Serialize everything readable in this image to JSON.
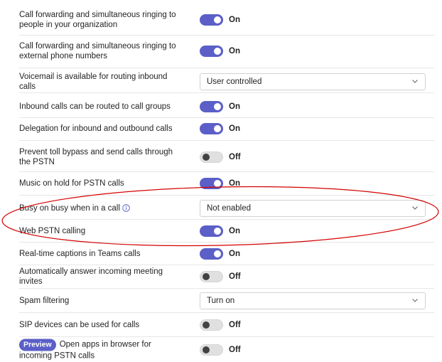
{
  "settings": [
    {
      "label": "Call forwarding and simultaneous ringing to people in your organization",
      "type": "toggle",
      "on": true,
      "state": "On"
    },
    {
      "label": "Call forwarding and simultaneous ringing to external phone numbers",
      "type": "toggle",
      "on": true,
      "state": "On"
    },
    {
      "label": "Voicemail is available for routing inbound calls",
      "type": "select",
      "value": "User controlled"
    },
    {
      "label": "Inbound calls can be routed to call groups",
      "type": "toggle",
      "on": true,
      "state": "On"
    },
    {
      "label": "Delegation for inbound and outbound calls",
      "type": "toggle",
      "on": true,
      "state": "On"
    },
    {
      "label": "Prevent toll bypass and send calls through the PSTN",
      "type": "toggle",
      "on": false,
      "state": "Off"
    },
    {
      "label": "Music on hold for PSTN calls",
      "type": "toggle",
      "on": true,
      "state": "On"
    },
    {
      "label": "Busy on busy when in a call",
      "type": "select",
      "value": "Not enabled",
      "info_icon": "info-icon"
    },
    {
      "label": "Web PSTN calling",
      "type": "toggle",
      "on": true,
      "state": "On"
    },
    {
      "label": "Real-time captions in Teams calls",
      "type": "toggle",
      "on": true,
      "state": "On"
    },
    {
      "label": "Automatically answer incoming meeting invites",
      "type": "toggle",
      "on": false,
      "state": "Off"
    },
    {
      "label": "Spam filtering",
      "type": "select",
      "value": "Turn on"
    },
    {
      "label": "SIP devices can be used for calls",
      "type": "toggle",
      "on": false,
      "state": "Off"
    },
    {
      "label": "Open apps in browser for incoming PSTN calls",
      "type": "toggle",
      "on": false,
      "state": "Off",
      "badge": "Preview"
    }
  ],
  "colors": {
    "accent": "#5b5fc7",
    "annotation": "#d40000",
    "divider": "#e6e6e6"
  },
  "icons": {
    "dropdown": "chevron-down-icon",
    "info": "info-icon"
  }
}
